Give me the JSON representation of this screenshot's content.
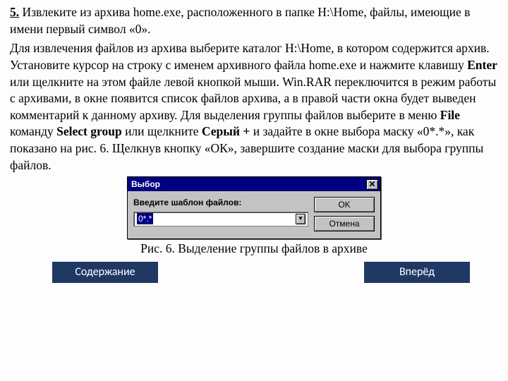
{
  "task": {
    "num": "5.",
    "text1": " Извлеките из архива home.exe, расположенного в папке H:\\Home, файлы, имеющие в имени первый символ «0»."
  },
  "p2": {
    "t1": "Для извлечения файлов из архива выберите каталог H:\\Home,  в котором содержится архив. Установите курсор на строку с именем архивного файла home.exe и нажмите клавишу ",
    "b1": "Enter",
    "t2": " или щелкните на этом файле левой кнопкой мыши. Win.RAR переключится в режим работы с архивами, в окне появится список файлов архива, а в правой части окна будет выведен комментарий к данному архиву. Для выделения группы файлов выберите в меню ",
    "b2": "File",
    "t3": " команду ",
    "b3": "Select group",
    "t4": " или щелкните ",
    "b4": "Серый +",
    "t5": " и задайте в окне выбора маску «0*.*», как показано на рис. 6. Щелкнув кнопку «ОК», завершите создание маски для выбора группы файлов."
  },
  "dialog": {
    "title": "Выбор",
    "label": "Введите шаблон файлов:",
    "value": "0*.*",
    "ok": "OK",
    "cancel": "Отмена"
  },
  "caption": "Рис. 6. Выделение группы файлов в архиве",
  "nav": {
    "contents": "Содержание",
    "next": "Вперёд"
  }
}
